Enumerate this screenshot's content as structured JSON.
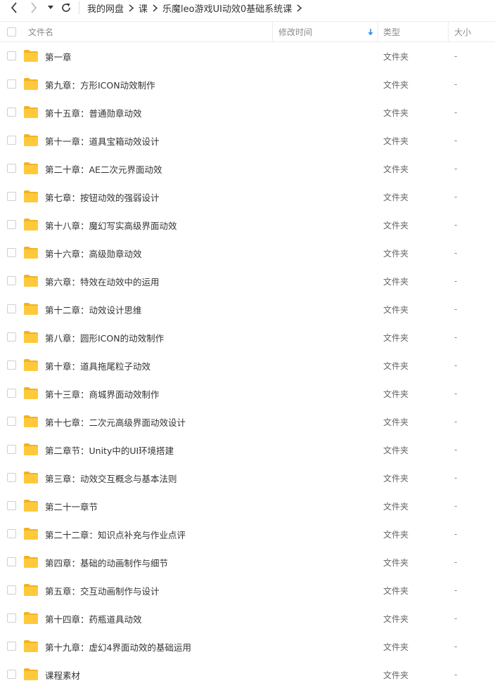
{
  "breadcrumb": {
    "items": [
      "我的网盘",
      "课",
      "乐魔leo游戏UI动效0基础系统课"
    ]
  },
  "columns": {
    "name": "文件名",
    "modified": "修改时间",
    "type": "类型",
    "size": "大小"
  },
  "icons": {
    "back": "chevron-left-icon",
    "forward": "chevron-right-icon",
    "dropdown": "caret-down-icon",
    "refresh": "refresh-icon",
    "folder": "folder-icon",
    "sort": "sort-down-arrow-icon"
  },
  "colors": {
    "folder": "#FFC93C",
    "sort_arrow": "#3b8ff5"
  },
  "files": [
    {
      "name": "第一章",
      "type": "文件夹",
      "size": "-"
    },
    {
      "name": "第九章：方形ICON动效制作",
      "type": "文件夹",
      "size": "-"
    },
    {
      "name": "第十五章：普通勋章动效",
      "type": "文件夹",
      "size": "-"
    },
    {
      "name": "第十一章：道具宝箱动效设计",
      "type": "文件夹",
      "size": "-"
    },
    {
      "name": "第二十章：AE二次元界面动效",
      "type": "文件夹",
      "size": "-"
    },
    {
      "name": "第七章：按钮动效的强弱设计",
      "type": "文件夹",
      "size": "-"
    },
    {
      "name": "第十八章：魔幻写实高级界面动效",
      "type": "文件夹",
      "size": "-"
    },
    {
      "name": "第十六章：高级勋章动效",
      "type": "文件夹",
      "size": "-"
    },
    {
      "name": "第六章：特效在动效中的运用",
      "type": "文件夹",
      "size": "-"
    },
    {
      "name": "第十二章：动效设计思维",
      "type": "文件夹",
      "size": "-"
    },
    {
      "name": "第八章：圆形ICON的动效制作",
      "type": "文件夹",
      "size": "-"
    },
    {
      "name": "第十章：道具拖尾粒子动效",
      "type": "文件夹",
      "size": "-"
    },
    {
      "name": "第十三章：商城界面动效制作",
      "type": "文件夹",
      "size": "-"
    },
    {
      "name": "第十七章：二次元高级界面动效设计",
      "type": "文件夹",
      "size": "-"
    },
    {
      "name": "第二章节：Unity中的UI环境搭建",
      "type": "文件夹",
      "size": "-"
    },
    {
      "name": "第三章：动效交互概念与基本法则",
      "type": "文件夹",
      "size": "-"
    },
    {
      "name": "第二十一章节",
      "type": "文件夹",
      "size": "-"
    },
    {
      "name": "第二十二章：知识点补充与作业点评",
      "type": "文件夹",
      "size": "-"
    },
    {
      "name": "第四章：基础的动画制作与细节",
      "type": "文件夹",
      "size": "-"
    },
    {
      "name": "第五章：交互动画制作与设计",
      "type": "文件夹",
      "size": "-"
    },
    {
      "name": "第十四章：药瓶道具动效",
      "type": "文件夹",
      "size": "-"
    },
    {
      "name": "第十九章：虚幻4界面动效的基础运用",
      "type": "文件夹",
      "size": "-"
    },
    {
      "name": "课程素材",
      "type": "文件夹",
      "size": "-"
    }
  ]
}
